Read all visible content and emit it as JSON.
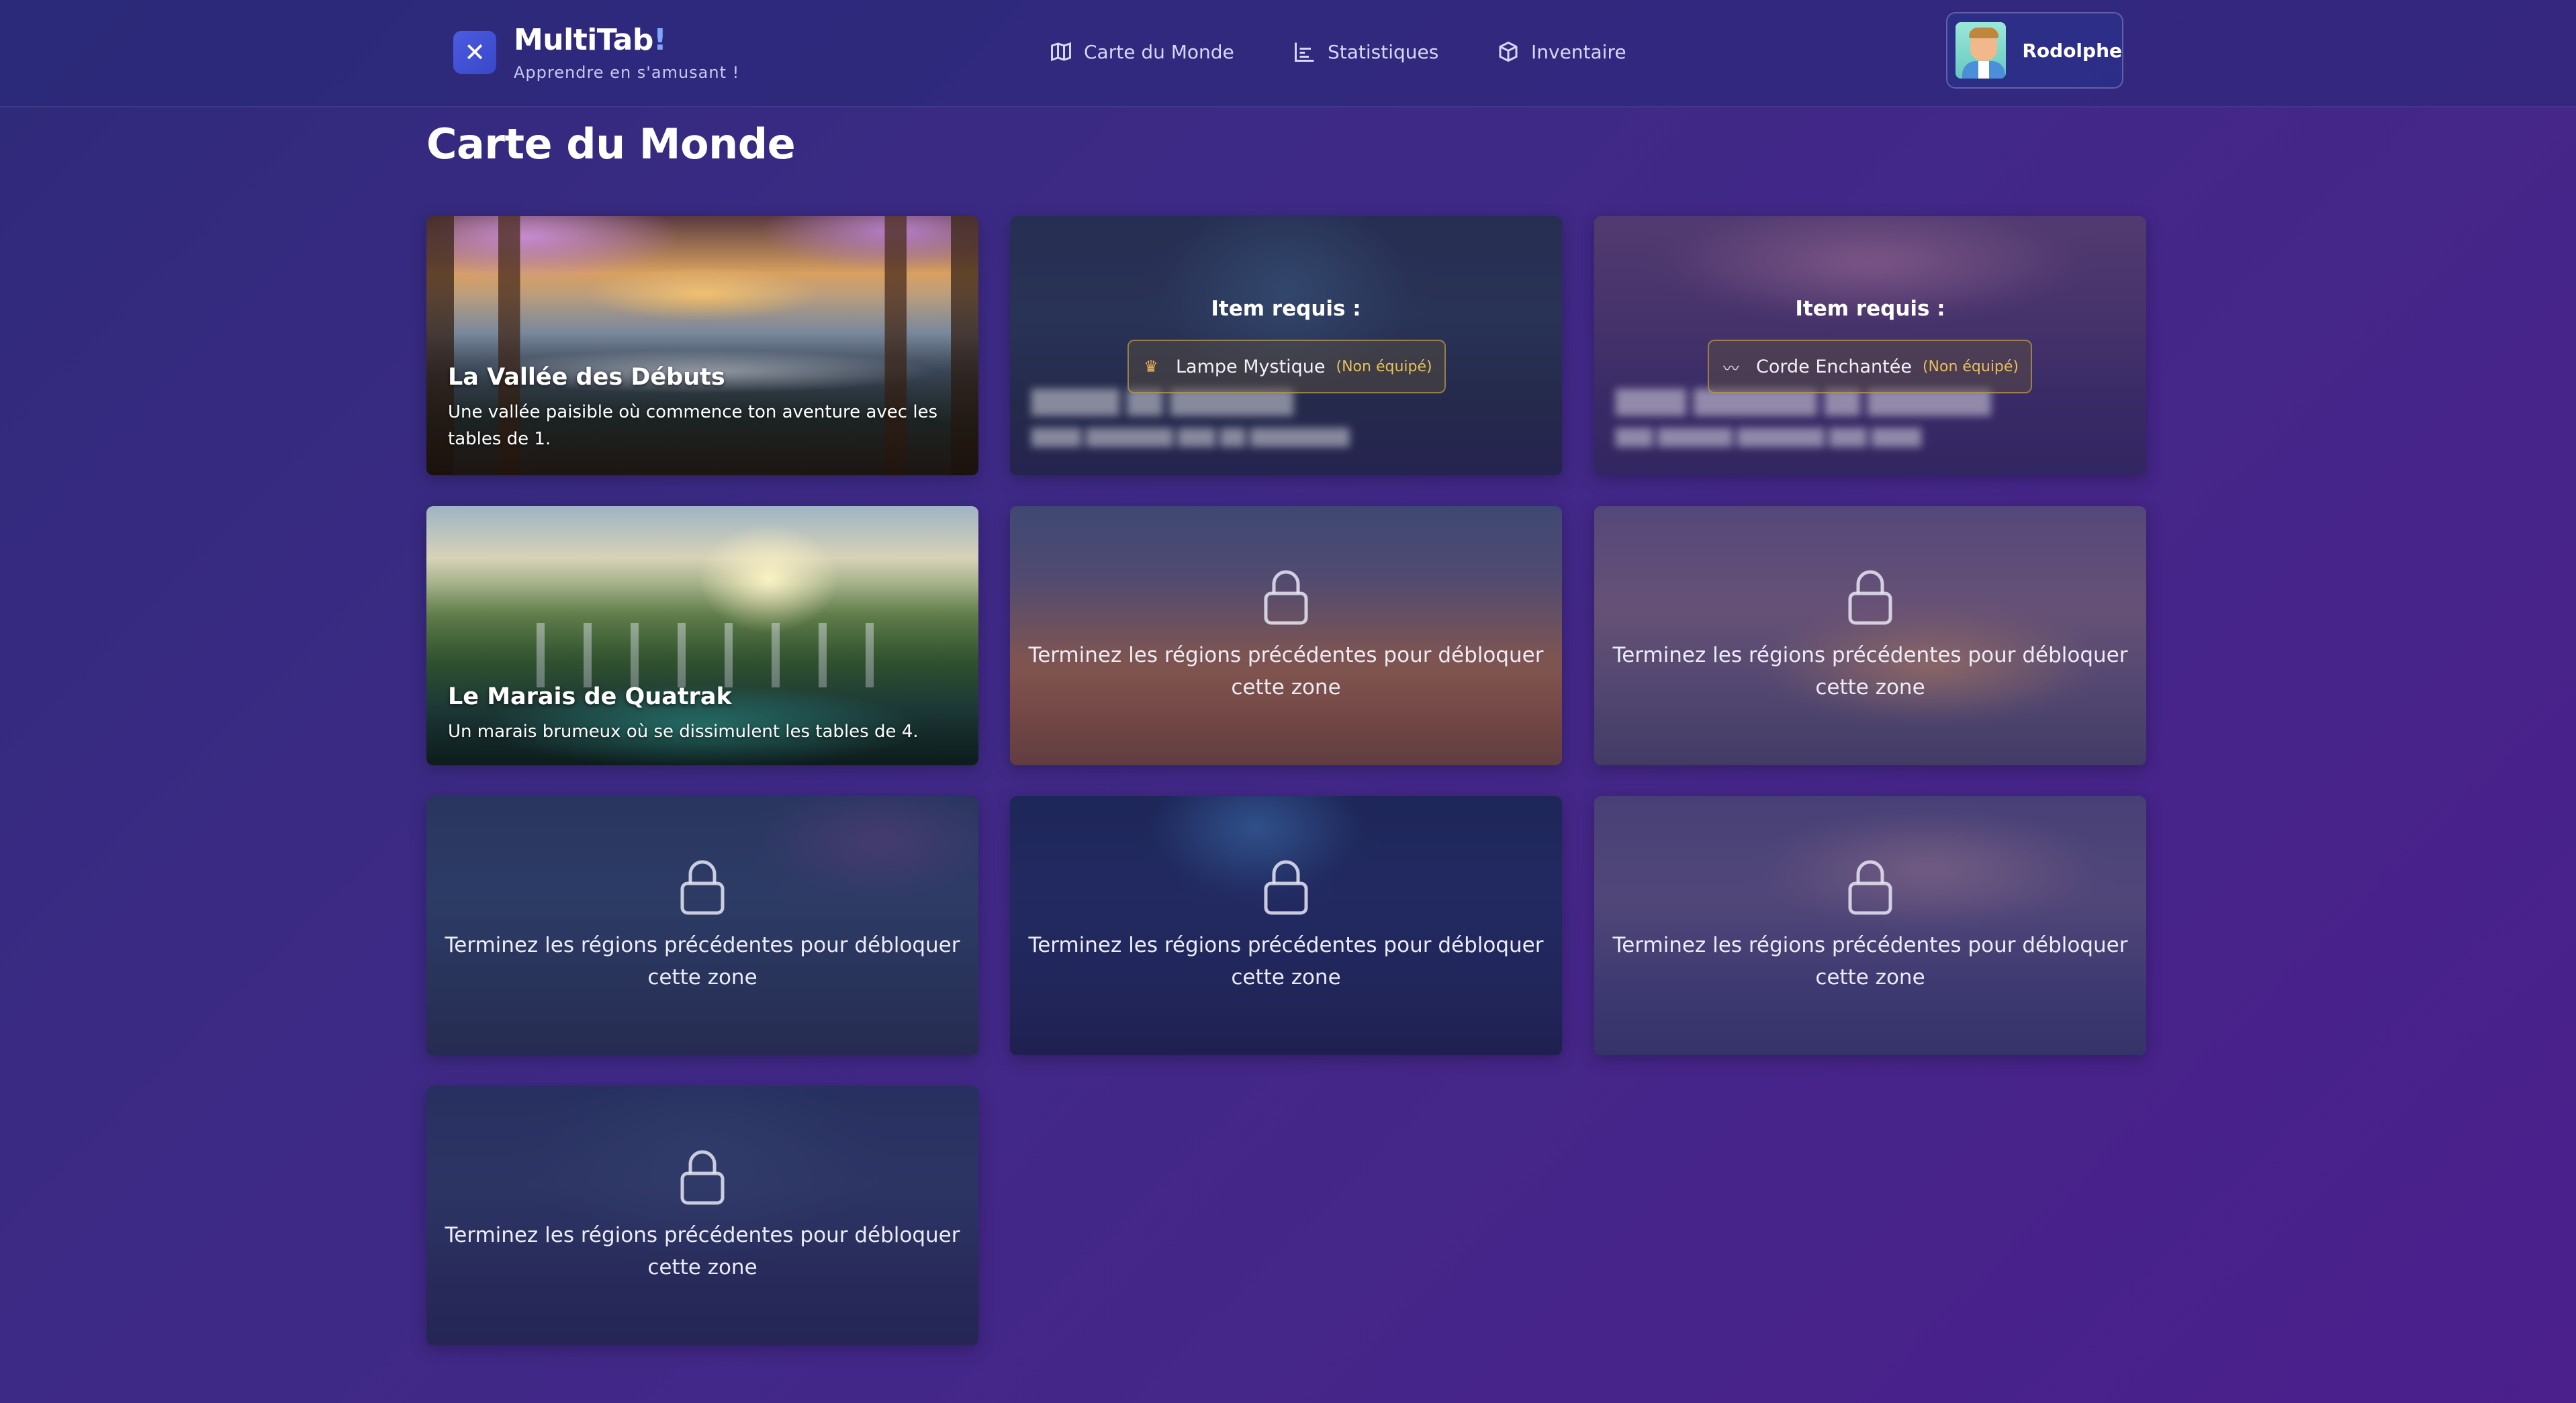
{
  "app": {
    "name": "MultiTab",
    "name_accent": "!",
    "tagline": "Apprendre en s'amusant !",
    "logo_icon": "close-x-icon"
  },
  "nav": [
    {
      "label": "Carte du Monde",
      "icon": "map-icon"
    },
    {
      "label": "Statistiques",
      "icon": "bar-chart-icon"
    },
    {
      "label": "Inventaire",
      "icon": "box-icon"
    }
  ],
  "user": {
    "name": "Rodolphe",
    "avatar": "avatar-icon"
  },
  "page": {
    "title": "Carte du Monde"
  },
  "regions": [
    {
      "title": "La Vallée des Débuts",
      "description": "Une vallée paisible où commence ton aventure avec les tables de 1.",
      "state": "unlocked"
    },
    {
      "state": "item_required",
      "required_label": "Item requis :",
      "item": "Lampe Mystique",
      "item_icon": "lamp-icon",
      "item_status": "(Non équipé)"
    },
    {
      "state": "item_required",
      "required_label": "Item requis :",
      "item": "Corde Enchantée",
      "item_icon": "rope-icon",
      "item_status": "(Non équipé)"
    },
    {
      "title": "Le Marais de Quatrak",
      "description": "Un marais brumeux où se dissimulent les tables de 4.",
      "state": "unlocked"
    },
    {
      "state": "locked",
      "lock_message": "Terminez les régions précédentes pour débloquer cette zone"
    },
    {
      "state": "locked",
      "lock_message": "Terminez les régions précédentes pour débloquer cette zone"
    },
    {
      "state": "locked",
      "lock_message": "Terminez les régions précédentes pour débloquer cette zone"
    },
    {
      "state": "locked",
      "lock_message": "Terminez les régions précédentes pour débloquer cette zone"
    },
    {
      "state": "locked",
      "lock_message": "Terminez les régions précédentes pour débloquer cette zone"
    },
    {
      "state": "locked",
      "lock_message": "Terminez les régions précédentes pour débloquer cette zone"
    }
  ]
}
